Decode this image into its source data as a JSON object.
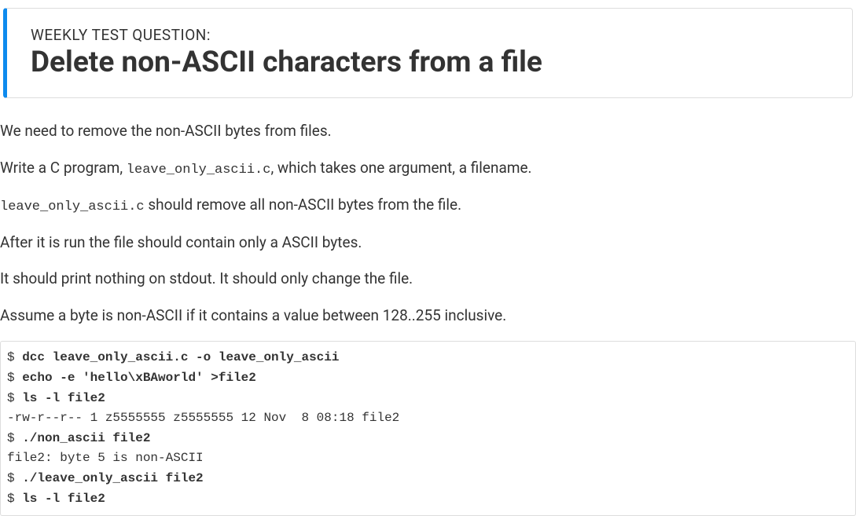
{
  "header": {
    "label": "WEEKLY TEST QUESTION:",
    "title": "Delete non-ASCII characters from a file"
  },
  "paragraphs": {
    "p1": "We need to remove the non-ASCII bytes from files.",
    "p2a": "Write a C program, ",
    "p2code": "leave_only_ascii.c",
    "p2b": ", which takes one argument, a filename.",
    "p3code": "leave_only_ascii.c",
    "p3b": " should remove all non-ASCII bytes from the file.",
    "p4": "After it is run the file should contain only a ASCII bytes.",
    "p5": "It should print nothing on stdout. It should only change the file.",
    "p6": "Assume a byte is non-ASCII if it contains a value between 128..255 inclusive."
  },
  "terminal": {
    "prompt": "$ ",
    "lines": [
      {
        "type": "cmd",
        "text": "dcc leave_only_ascii.c -o leave_only_ascii"
      },
      {
        "type": "cmd",
        "text": "echo -e 'hello\\xBAworld' >file2"
      },
      {
        "type": "cmd",
        "text": "ls -l file2"
      },
      {
        "type": "out",
        "text": "-rw-r--r-- 1 z5555555 z5555555 12 Nov  8 08:18 file2"
      },
      {
        "type": "cmd",
        "text": "./non_ascii file2"
      },
      {
        "type": "out",
        "text": "file2: byte 5 is non-ASCII"
      },
      {
        "type": "cmd",
        "text": "./leave_only_ascii file2"
      },
      {
        "type": "cmd",
        "text": "ls -l file2"
      }
    ]
  }
}
